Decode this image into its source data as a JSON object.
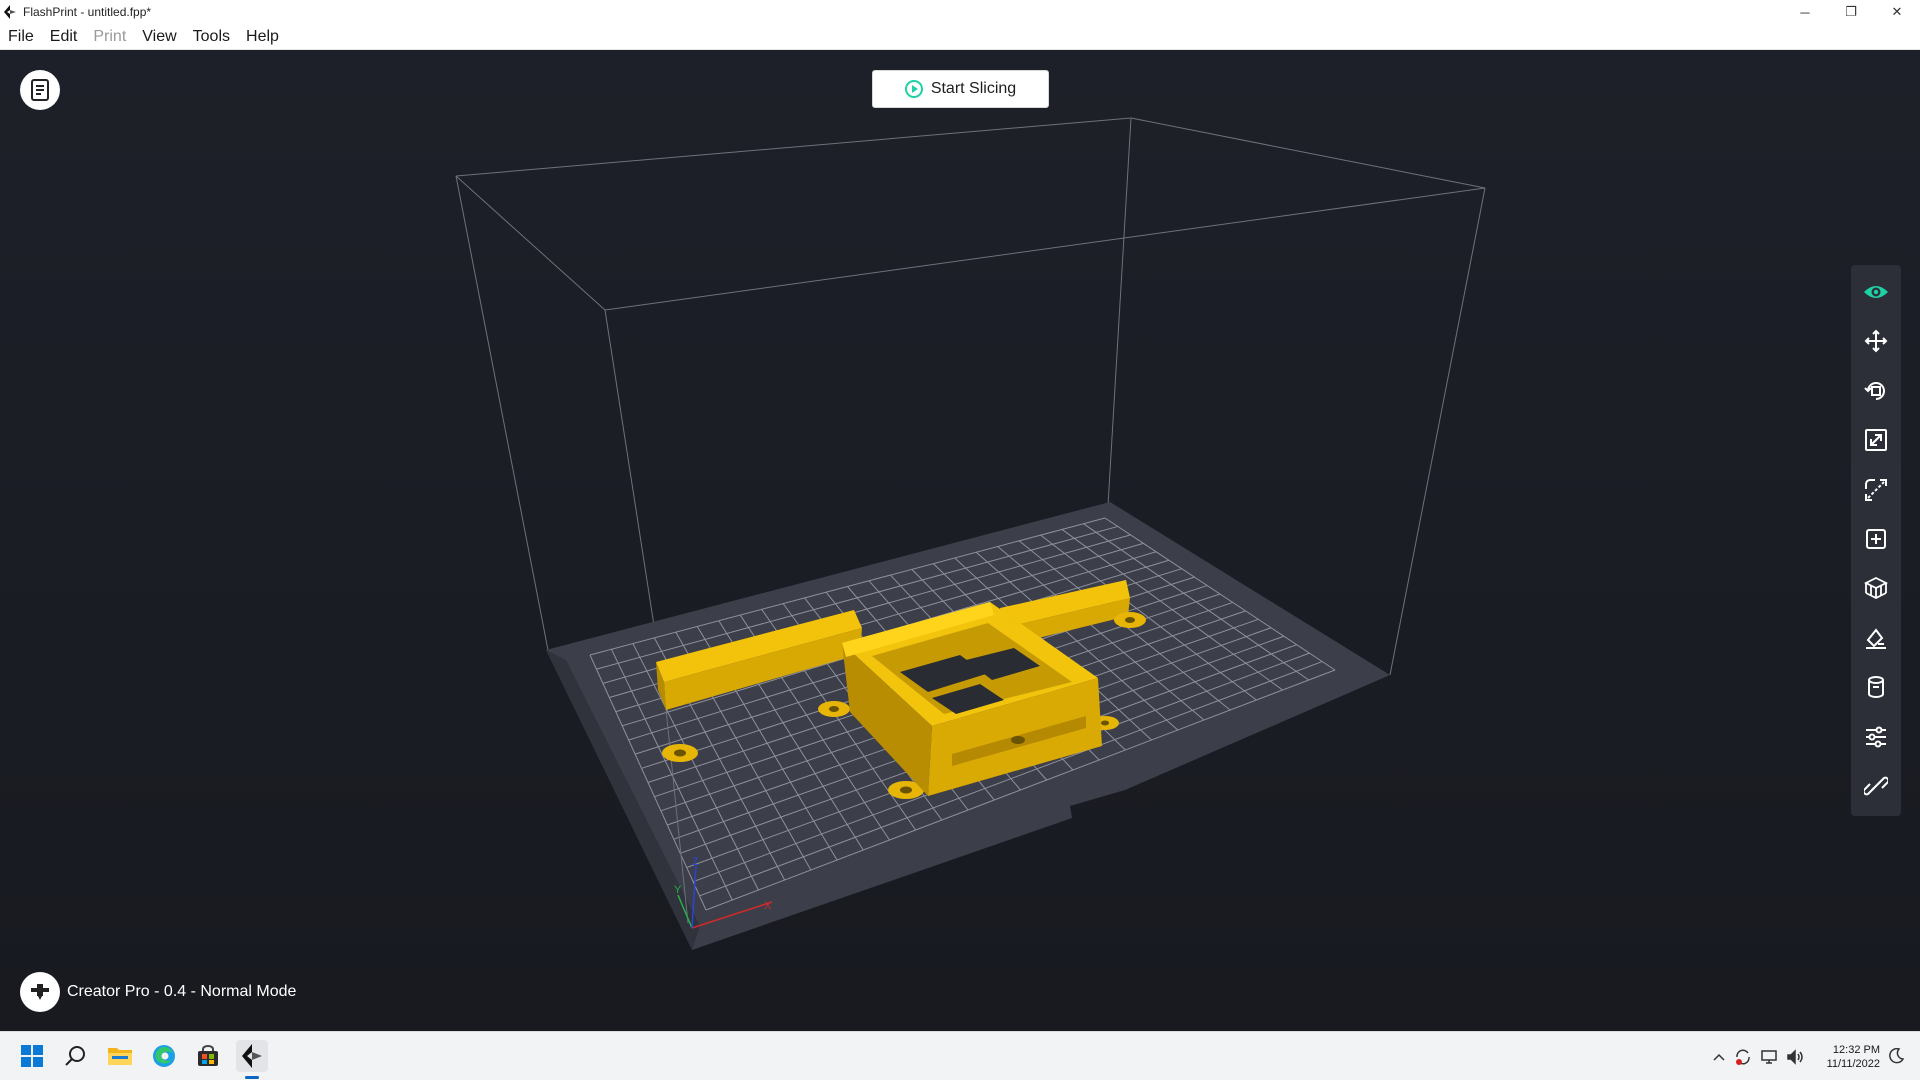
{
  "window": {
    "title": "FlashPrint - untitled.fpp*",
    "controls": {
      "minimize": "─",
      "restore": "❐",
      "close": "✕"
    }
  },
  "menu": [
    "File",
    "Edit",
    "Print",
    "View",
    "Tools",
    "Help"
  ],
  "menu_disabled": [
    "Print"
  ],
  "viewport": {
    "start_slicing_label": "Start Slicing",
    "file_button_icon": "document-icon",
    "machine_status": "Creator Pro - 0.4 - Normal Mode",
    "machine_icon": "nozzle-icon",
    "axes": {
      "x": "X",
      "y": "Y",
      "z": "Z"
    }
  },
  "toolbar": {
    "tools": [
      {
        "name": "view",
        "icon": "eye-icon",
        "active": true
      },
      {
        "name": "move",
        "icon": "move-arrows-icon"
      },
      {
        "name": "rotate",
        "icon": "rotate-icon"
      },
      {
        "name": "scale",
        "icon": "scale-icon"
      },
      {
        "name": "cut",
        "icon": "cut-icon"
      },
      {
        "name": "add",
        "icon": "add-object-icon"
      },
      {
        "name": "supports",
        "icon": "supports-icon"
      },
      {
        "name": "lay-flat",
        "icon": "lay-flat-icon"
      },
      {
        "name": "material",
        "icon": "cylinder-icon"
      },
      {
        "name": "settings",
        "icon": "sliders-icon"
      },
      {
        "name": "connect",
        "icon": "link-icon"
      }
    ]
  },
  "taskbar": {
    "apps": [
      "windows-start-icon",
      "search-icon",
      "file-explorer-icon",
      "edge-browser-icon",
      "store-icon",
      "flashprint-icon"
    ],
    "time": "12:32 PM",
    "date": "11/11/2022"
  },
  "colors": {
    "accent": "#1fd1a6",
    "model": "#e8b704",
    "viewport_bg": "#1b1d24",
    "plate": "#3a3c47",
    "grid": "#8c8f99",
    "toolbar_bg": "#2c2f38"
  }
}
